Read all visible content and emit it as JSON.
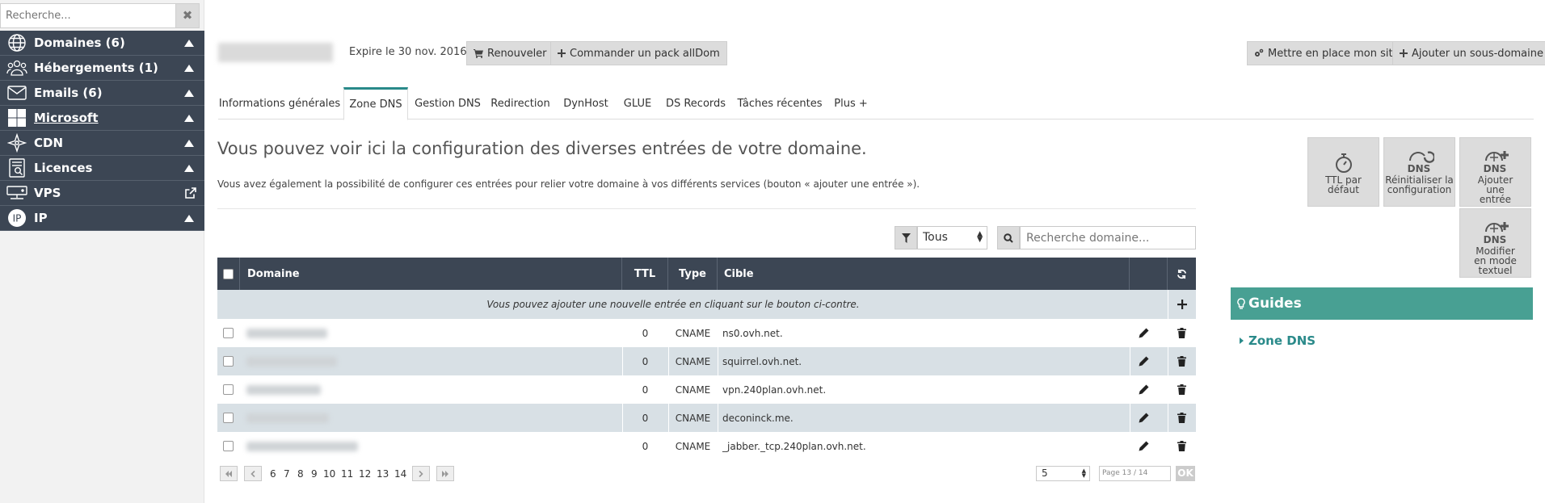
{
  "sidebar": {
    "search_placeholder": "Recherche...",
    "clear_icon": "✖",
    "items": [
      {
        "label": "Domaines (6)",
        "icon": "globe-icon"
      },
      {
        "label": "Hébergements (1)",
        "icon": "people-icon"
      },
      {
        "label": "Emails (6)",
        "icon": "envelope-icon"
      },
      {
        "label": "Microsoft",
        "icon": "windows-icon"
      },
      {
        "label": "CDN",
        "icon": "cdn-icon"
      },
      {
        "label": "Licences",
        "icon": "license-icon"
      },
      {
        "label": "VPS",
        "icon": "server-icon"
      },
      {
        "label": "IP",
        "icon": "ip-icon"
      }
    ]
  },
  "header": {
    "expire": "Expire le 30 nov. 2016",
    "renew": "Renouveler",
    "order_pack": "Commander un pack allDom",
    "setup_site": "Mettre en place mon site",
    "add_subdomain": "Ajouter un sous-domaine"
  },
  "tabs": [
    {
      "label": "Informations générales"
    },
    {
      "label": "Zone DNS"
    },
    {
      "label": "Gestion DNS"
    },
    {
      "label": "Redirection"
    },
    {
      "label": "DynHost"
    },
    {
      "label": "GLUE"
    },
    {
      "label": "DS Records"
    },
    {
      "label": "Tâches récentes"
    },
    {
      "label": "Plus +"
    }
  ],
  "main": {
    "title": "Vous pouvez voir ici la configuration des diverses entrées de votre domaine.",
    "description": "Vous avez également la possibilité de configurer ces entrées pour relier votre domaine à vos différents services (bouton « ajouter une entrée »).",
    "filter_value": "Tous",
    "search_placeholder": "Recherche domaine..."
  },
  "table": {
    "headers": {
      "domain": "Domaine",
      "ttl": "TTL",
      "type": "Type",
      "target": "Cible"
    },
    "info": "Vous pouvez ajouter une nouvelle entrée en cliquant sur le bouton ci-contre.",
    "rows": [
      {
        "ttl": "0",
        "type": "CNAME",
        "target": "ns0.ovh.net."
      },
      {
        "ttl": "0",
        "type": "CNAME",
        "target": "squirrel.ovh.net."
      },
      {
        "ttl": "0",
        "type": "CNAME",
        "target": "vpn.240plan.ovh.net."
      },
      {
        "ttl": "0",
        "type": "CNAME",
        "target": "deconinck.me."
      },
      {
        "ttl": "0",
        "type": "CNAME",
        "target": "_jabber._tcp.240plan.ovh.net."
      }
    ]
  },
  "pagination": {
    "pages": [
      "6",
      "7",
      "8",
      "9",
      "10",
      "11",
      "12",
      "13",
      "14"
    ],
    "current_page": "13",
    "per_page": "5",
    "page_info": "Page 13 / 14",
    "ok": "OK"
  },
  "actions": {
    "ttl": "TTL par défaut",
    "reset": "Réinitialiser la configuration",
    "add_entry": "Ajouter une entrée",
    "edit_text": "Modifier en mode textuel",
    "dns_badge": "DNS"
  },
  "guides": {
    "title": "Guides",
    "link": "Zone DNS"
  },
  "colors": {
    "sidebar_bg": "#3c4654",
    "accent": "#48a093",
    "link": "#2a8a8a",
    "alt_row": "#d8e0e5"
  }
}
